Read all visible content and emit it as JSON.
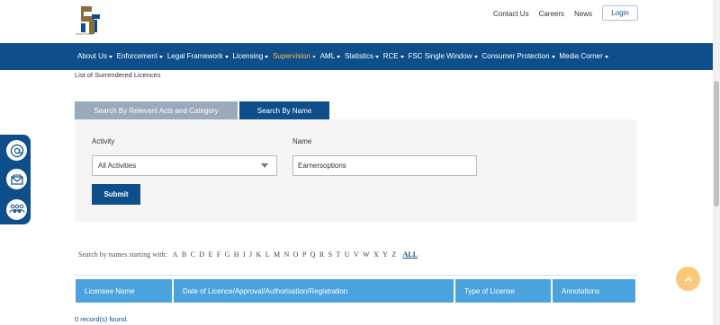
{
  "header": {
    "logo_word": "mauritius",
    "links": [
      "Contact Us",
      "Careers",
      "News"
    ],
    "login_label": "Login"
  },
  "nav": {
    "items": [
      {
        "label": "About Us",
        "active": false
      },
      {
        "label": "Enforcement",
        "active": false
      },
      {
        "label": "Legal Framework",
        "active": false
      },
      {
        "label": "Licensing",
        "active": false
      },
      {
        "label": "Supervision",
        "active": true
      },
      {
        "label": "AML",
        "active": false
      },
      {
        "label": "Statistics",
        "active": false
      },
      {
        "label": "RCE",
        "active": false
      },
      {
        "label": "FSC Single Window",
        "active": false
      },
      {
        "label": "Consumer Protection",
        "active": false
      },
      {
        "label": "Media Corner",
        "active": false
      }
    ]
  },
  "page": {
    "title": "List of Surrendered Licences"
  },
  "tabs": {
    "acts": "Search By Relevant Acts and Category",
    "name": "Search By Name"
  },
  "search": {
    "activity_label": "Activity",
    "activity_value": "All Activities",
    "name_label": "Name",
    "name_value": "Earnersoptions",
    "submit_label": "Submit"
  },
  "alphabet": {
    "label": "Search by names starting with:",
    "letters": [
      "A",
      "B",
      "C",
      "D",
      "E",
      "F",
      "G",
      "H",
      "I",
      "J",
      "K",
      "L",
      "M",
      "N",
      "O",
      "P",
      "Q",
      "R",
      "S",
      "T",
      "U",
      "V",
      "W",
      "X",
      "Y",
      "Z"
    ],
    "all_label": "ALL"
  },
  "table": {
    "columns": [
      "Licensee Name",
      "Date of Licence/Approval/Authorisation/Registration",
      "Type of License",
      "Annotations"
    ]
  },
  "records_text": "0 record(s) found.",
  "colors": {
    "primary": "#0e4f8b",
    "nav_active": "#f3c14b",
    "table_header": "#4aa3df",
    "tab_inactive": "#9aa9bb",
    "to_top": "#fbc77a"
  },
  "icons": {
    "side": [
      "at-sign-icon",
      "envelope-icon",
      "people-group-icon"
    ],
    "to_top": "chevron-up-icon"
  }
}
